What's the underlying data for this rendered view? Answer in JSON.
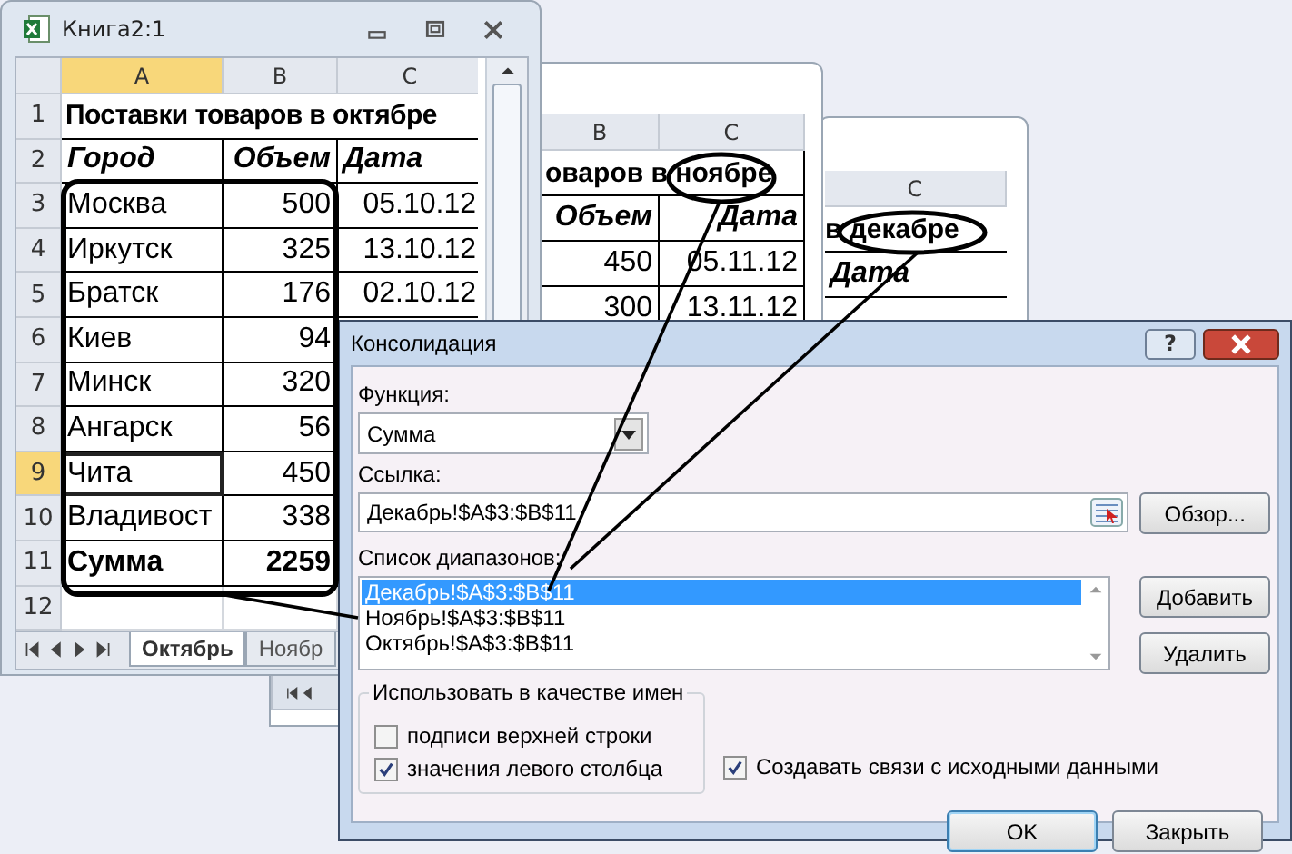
{
  "workbook_front": {
    "title": "Книга2:1",
    "columns": [
      {
        "label": "A",
        "selected": true
      },
      {
        "label": "B",
        "selected": false
      },
      {
        "label": "C",
        "selected": false
      }
    ],
    "rows": [
      {
        "number": "1",
        "selected": false,
        "kind": "title",
        "cells": [
          "Поставки товаров в октябре"
        ]
      },
      {
        "number": "2",
        "selected": false,
        "kind": "header",
        "cells": [
          "Город",
          "Объем",
          "Дата"
        ]
      },
      {
        "number": "3",
        "selected": false,
        "kind": "data",
        "cells": [
          "Москва",
          "500",
          "05.10.12"
        ]
      },
      {
        "number": "4",
        "selected": false,
        "kind": "data",
        "cells": [
          "Иркутск",
          "325",
          "13.10.12"
        ]
      },
      {
        "number": "5",
        "selected": false,
        "kind": "data",
        "cells": [
          "Братск",
          "176",
          "02.10.12"
        ]
      },
      {
        "number": "6",
        "selected": false,
        "kind": "data",
        "cells": [
          "Киев",
          "94"
        ]
      },
      {
        "number": "7",
        "selected": false,
        "kind": "data",
        "cells": [
          "Минск",
          "320"
        ]
      },
      {
        "number": "8",
        "selected": false,
        "kind": "data",
        "cells": [
          "Ангарск",
          "56"
        ]
      },
      {
        "number": "9",
        "selected": true,
        "kind": "data",
        "cells": [
          "Чита",
          "450"
        ]
      },
      {
        "number": "10",
        "selected": false,
        "kind": "data",
        "cells": [
          "Владивост",
          "338"
        ]
      },
      {
        "number": "11",
        "selected": false,
        "kind": "total",
        "cells": [
          "Сумма",
          "2259"
        ]
      },
      {
        "number": "12",
        "selected": false,
        "kind": "empty",
        "cells": []
      }
    ],
    "sheet_tabs": [
      {
        "label": "Октябрь",
        "selected": true
      },
      {
        "label": "Ноябр",
        "selected": false
      }
    ]
  },
  "workbook_middle": {
    "columns": [
      "B",
      "C"
    ],
    "rows": [
      {
        "kind": "title",
        "cells": [
          "оваров в ноябре"
        ]
      },
      {
        "kind": "header",
        "cells": [
          "Объем",
          "Дата"
        ]
      },
      {
        "kind": "data",
        "cells": [
          "450",
          "05.11.12"
        ]
      },
      {
        "kind": "data",
        "cells": [
          "300",
          "13.11.12"
        ]
      }
    ]
  },
  "workbook_back": {
    "columns": [
      "C"
    ],
    "rows": [
      {
        "kind": "title",
        "cells": [
          "в декабре"
        ]
      },
      {
        "kind": "header",
        "cells": [
          "Дата"
        ]
      }
    ]
  },
  "dialog": {
    "title": "Консолидация",
    "help_button": "?",
    "function": {
      "label": "Функция:",
      "value": "Сумма"
    },
    "reference": {
      "label": "Ссылка:",
      "value": "Декабрь!$A$3:$B$11"
    },
    "browse_button": "Обзор...",
    "ranges": {
      "label": "Список диапазонов:",
      "items": [
        {
          "text": "Декабрь!$A$3:$B$11",
          "selected": true
        },
        {
          "text": "Ноябрь!$A$3:$B$11",
          "selected": false
        },
        {
          "text": "Октябрь!$A$3:$B$11",
          "selected": false
        }
      ]
    },
    "add_button": "Добавить",
    "delete_button": "Удалить",
    "names_group": {
      "label": "Использовать в качестве имен",
      "options": [
        {
          "label": "подписи верхней строки",
          "checked": false
        },
        {
          "label": "значения левого столбца",
          "checked": true
        }
      ]
    },
    "links_option": {
      "label": "Создавать связи с исходными данными",
      "checked": true
    },
    "buttons": [
      {
        "label": "OK",
        "kind": "default"
      },
      {
        "label": "Закрыть",
        "kind": "normal"
      }
    ]
  }
}
